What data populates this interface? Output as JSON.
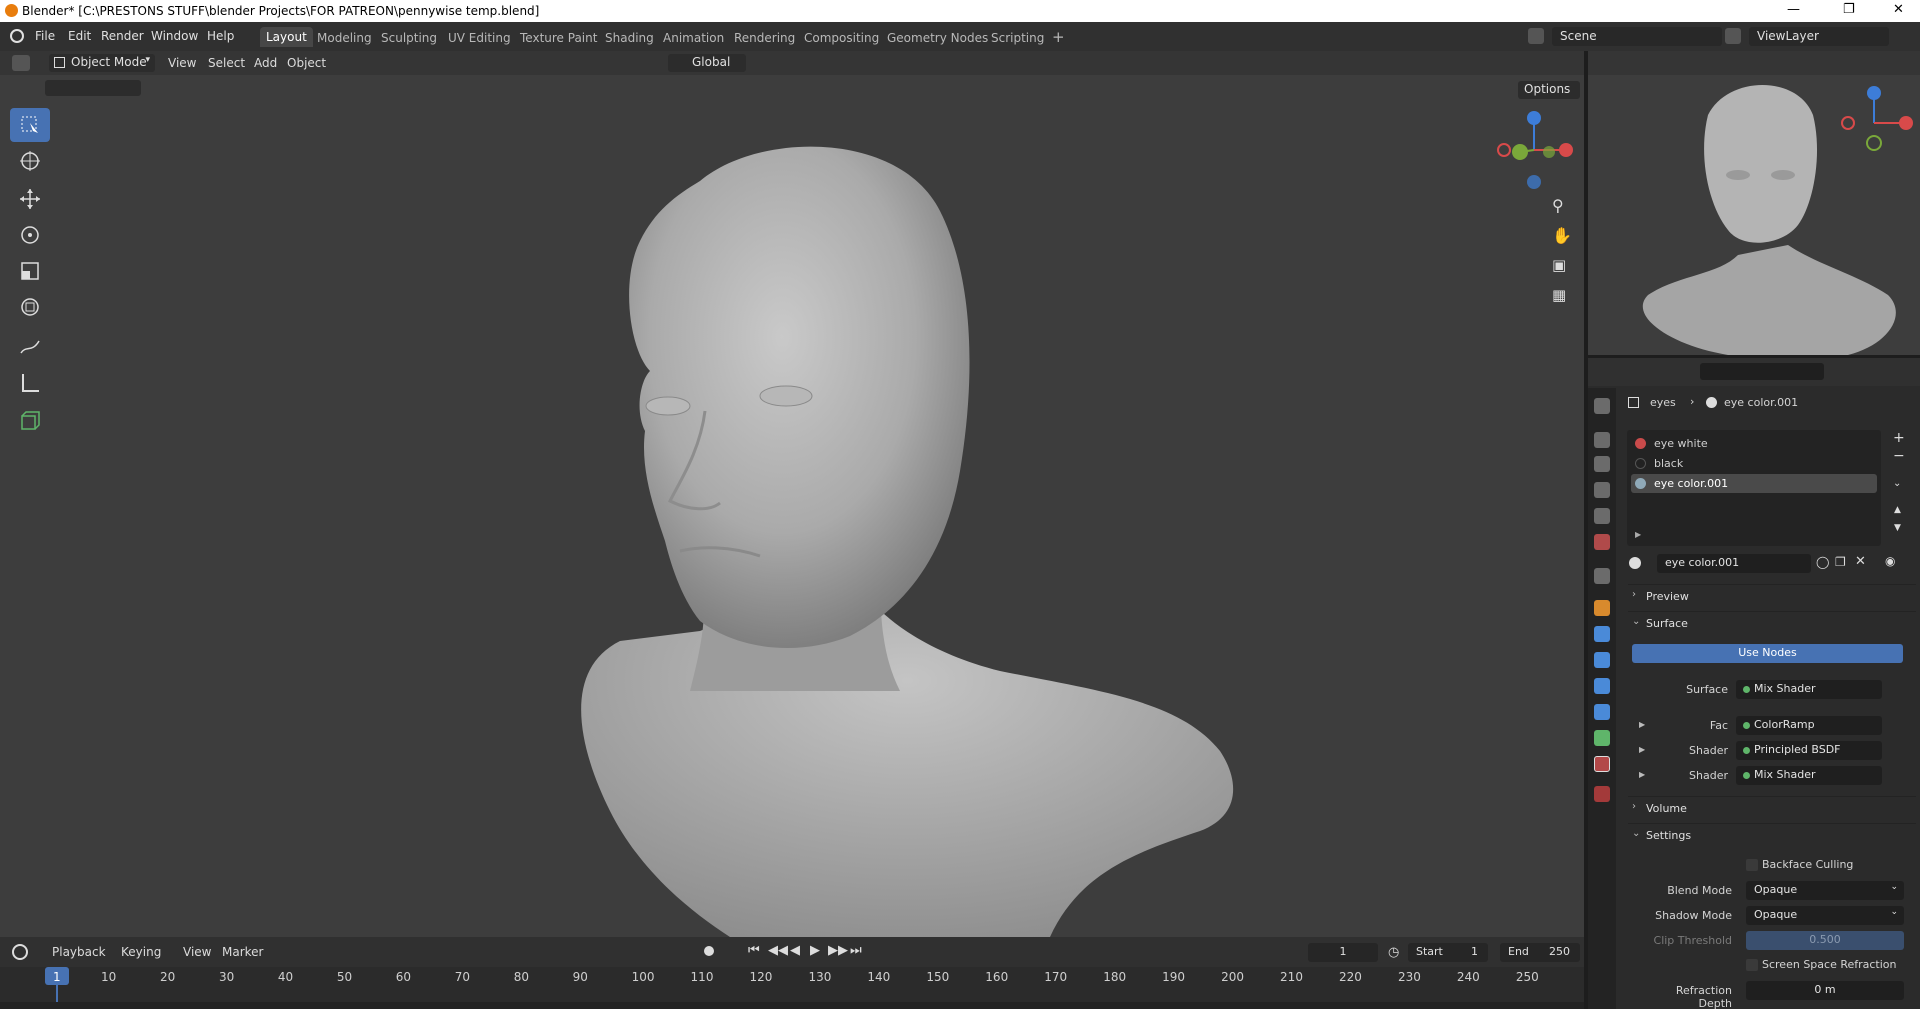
{
  "titlebar": {
    "title": "Blender* [C:\\PRESTONS STUFF\\blender Projects\\FOR PATREON\\pennywise temp.blend]"
  },
  "menu": [
    "File",
    "Edit",
    "Render",
    "Window",
    "Help"
  ],
  "workspaces": [
    "Layout",
    "Modeling",
    "Sculpting",
    "UV Editing",
    "Texture Paint",
    "Shading",
    "Animation",
    "Rendering",
    "Compositing",
    "Geometry Nodes",
    "Scripting"
  ],
  "active_workspace": "Layout",
  "scene": {
    "name": "Scene",
    "view_layer": "ViewLayer"
  },
  "viewport": {
    "mode": "Object Mode",
    "menus": [
      "View",
      "Select",
      "Add",
      "Object"
    ],
    "transform_orientation": "Global",
    "options_label": "Options"
  },
  "properties": {
    "breadcrumb": {
      "object": "eyes",
      "material": "eye color.001"
    },
    "material_slots": [
      {
        "name": "eye white",
        "color": "#c94b4b"
      },
      {
        "name": "black",
        "color": "#222222"
      },
      {
        "name": "eye color.001",
        "color": "#8fa9b8"
      }
    ],
    "material_name": "eye color.001",
    "panels": {
      "preview": "Preview",
      "surface": "Surface",
      "volume": "Volume",
      "settings": "Settings"
    },
    "use_nodes_label": "Use Nodes",
    "surface_rows": [
      {
        "label": "Surface",
        "value": "Mix Shader"
      },
      {
        "label": "Fac",
        "value": "ColorRamp"
      },
      {
        "label": "Shader",
        "value": "Principled BSDF"
      },
      {
        "label": "Shader",
        "value": "Mix Shader"
      }
    ],
    "settings": {
      "backface_culling": "Backface Culling",
      "blend_mode_label": "Blend Mode",
      "blend_mode": "Opaque",
      "shadow_mode_label": "Shadow Mode",
      "shadow_mode": "Opaque",
      "clip_threshold_label": "Clip Threshold",
      "clip_threshold": "0.500",
      "screen_space_refraction": "Screen Space Refraction",
      "refraction_depth_label": "Refraction Depth",
      "refraction_depth": "0 m"
    }
  },
  "timeline": {
    "menus": [
      "Playback",
      "Keying",
      "View",
      "Marker"
    ],
    "current_frame": "1",
    "start_label": "Start",
    "start": "1",
    "end_label": "End",
    "end": "250",
    "ticks": [
      "1",
      "10",
      "20",
      "30",
      "40",
      "50",
      "60",
      "70",
      "80",
      "90",
      "100",
      "110",
      "120",
      "130",
      "140",
      "150",
      "160",
      "170",
      "180",
      "190",
      "200",
      "210",
      "220",
      "230",
      "240",
      "250"
    ]
  },
  "colors": {
    "accent": "#4772b3",
    "viewport_bg": "#3d3d3d",
    "panel_bg": "#2b2b2b"
  }
}
